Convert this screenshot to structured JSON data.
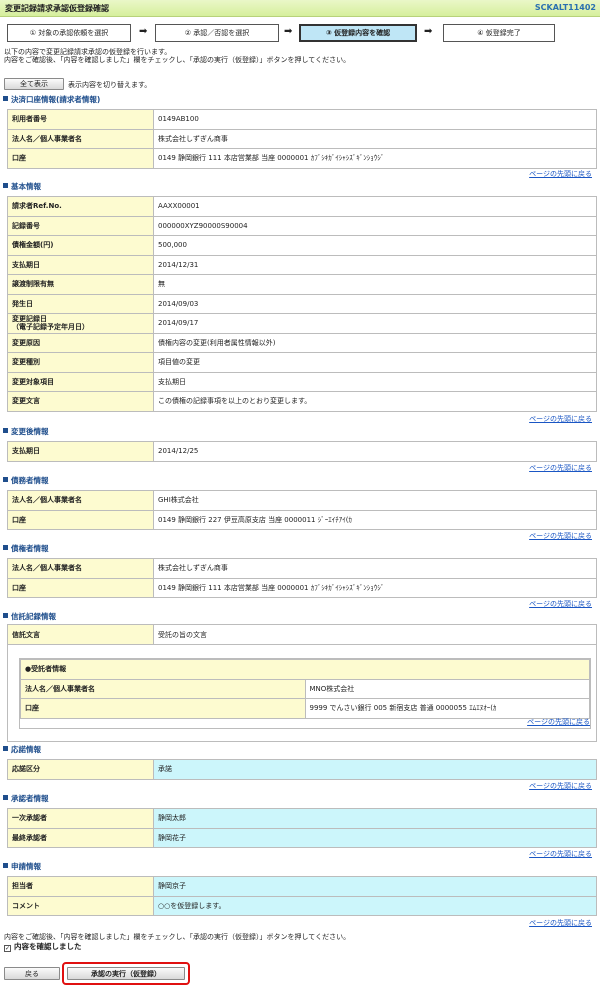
{
  "header": {
    "title": "変更記録請求承認仮登録確認",
    "screen_id": "SCKALT11402"
  },
  "steps": [
    {
      "label": "① 対象の承認依頼を選択"
    },
    {
      "label": "② 承認／否認を選択"
    },
    {
      "label": "③ 仮登録内容を確認",
      "active": true
    },
    {
      "label": "④ 仮登録完了"
    }
  ],
  "arrow_glyph": "➡",
  "intro": {
    "line1": "以下の内容で変更記録請求承認の仮登録を行います。",
    "line2": "内容をご確認後、「内容を確認しました」欄をチェックし、「承認の実行（仮登録）」ボタンを押してください。"
  },
  "show_all": {
    "label": "全て表示",
    "note": "表示内容を切り替えます。"
  },
  "top_link": "ページの先頭に戻る",
  "settlement": {
    "title": "決済口座情報(請求者情報)",
    "rows": [
      {
        "k": "利用者番号",
        "v": "0149AB100"
      },
      {
        "k": "法人名／個人事業者名",
        "v": "株式会社しずぎん商事"
      },
      {
        "k": "口座",
        "v": "0149 静岡銀行 111 本店営業部 当座 0000001 ｶﾌﾞｼｷｶﾞｲｼｬｼｽﾞｷﾞﾝｼｮｳｼﾞ"
      }
    ]
  },
  "basic": {
    "title": "基本情報",
    "rows": [
      {
        "k": "請求者Ref.No.",
        "v": "AAXX00001"
      },
      {
        "k": "記録番号",
        "v": "000000XYZ90000S90004"
      },
      {
        "k": "債権金額(円)",
        "v": "500,000"
      },
      {
        "k": "支払期日",
        "v": "2014/12/31"
      },
      {
        "k": "譲渡制限有無",
        "v": "無"
      },
      {
        "k": "発生日",
        "v": "2014/09/03"
      },
      {
        "k": "変更記録日",
        "k2": "（電子記録予定年月日）",
        "v": "2014/09/17"
      },
      {
        "k": "変更原因",
        "v": "債権内容の変更(利用者属性情報以外)"
      },
      {
        "k": "変更種別",
        "v": "項目値の変更"
      },
      {
        "k": "変更対象項目",
        "v": "支払期日"
      },
      {
        "k": "変更文言",
        "v": "この債権の記録事項を以上のとおり変更します。"
      }
    ]
  },
  "after": {
    "title": "変更後情報",
    "rows": [
      {
        "k": "支払期日",
        "v": "2014/12/25"
      }
    ]
  },
  "debtor": {
    "title": "債務者情報",
    "rows": [
      {
        "k": "法人名／個人事業者名",
        "v": "GHI株式会社"
      },
      {
        "k": "口座",
        "v": "0149 静岡銀行 227 伊豆高原支店 当座 0000011 ｼﾞｰｴｲﾁｱｲ(ｶ"
      }
    ]
  },
  "creditor": {
    "title": "債権者情報",
    "rows": [
      {
        "k": "法人名／個人事業者名",
        "v": "株式会社しずぎん商事"
      },
      {
        "k": "口座",
        "v": "0149 静岡銀行 111 本店営業部 当座 0000001 ｶﾌﾞｼｷｶﾞｲｼｬｼｽﾞｷﾞﾝｼｮｳｼﾞ"
      }
    ]
  },
  "trust": {
    "title": "信託記録情報",
    "label": "信託文言",
    "value": "受託の旨の文言",
    "trustee_title": "●受託者情報",
    "trustee_rows": [
      {
        "k": "法人名／個人事業者名",
        "v": "MNO株式会社"
      },
      {
        "k": "口座",
        "v": "9999 でんさい銀行 005 新宿支店 普通 0000055 ｴﾑｴﾇｵｰ(ｶ"
      }
    ]
  },
  "response": {
    "title": "応諾情報",
    "rows": [
      {
        "k": "応諾区分",
        "v": "承諾"
      }
    ]
  },
  "approver": {
    "title": "承認者情報",
    "rows": [
      {
        "k": "一次承認者",
        "v": "静岡太郎"
      },
      {
        "k": "最終承認者",
        "v": "静岡花子"
      }
    ]
  },
  "application": {
    "title": "申請情報",
    "rows": [
      {
        "k": "担当者",
        "v": "静岡京子"
      },
      {
        "k": "コメント",
        "v": "○○を仮登録します。"
      }
    ]
  },
  "confirm": {
    "text": "内容をご確認後、「内容を確認しました」欄をチェックし、「承認の実行（仮登録）」ボタンを押してください。",
    "checkbox_label": "内容を確認しました",
    "checked": true
  },
  "buttons": {
    "back": "戻る",
    "execute": "承認の実行（仮登録）"
  },
  "colors": {
    "label_bg": "#fdfbd0",
    "cyan_bg": "#ccf6fb",
    "section_blue": "#1f4e8c",
    "highlight_red": "#e01010"
  }
}
